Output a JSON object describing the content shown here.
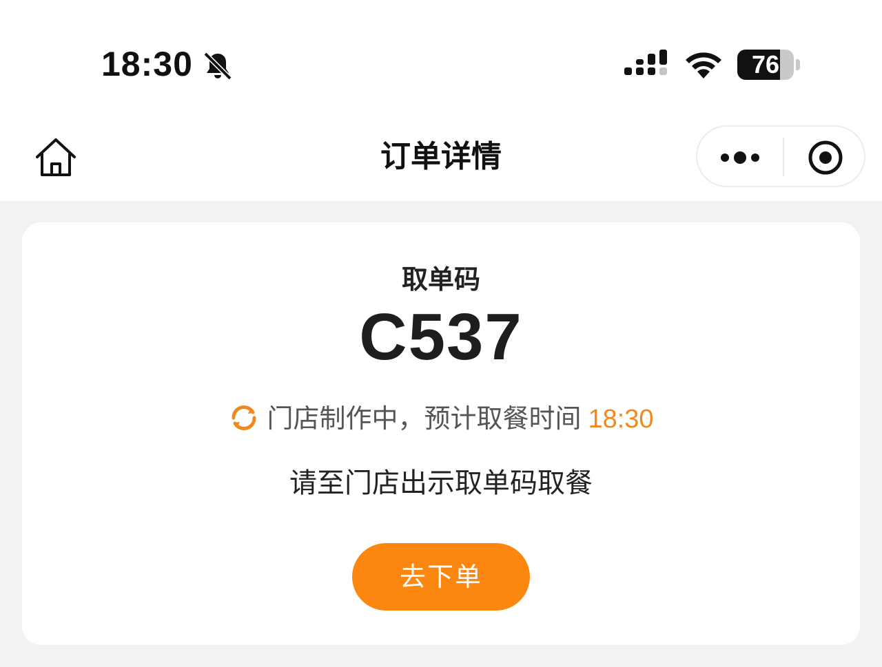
{
  "status_bar": {
    "time": "18:30",
    "battery_level": 76,
    "battery_text": "76",
    "icons": [
      "bell-slash-icon",
      "signal-icon",
      "wifi-icon",
      "battery-icon"
    ]
  },
  "nav": {
    "title": "订单详情",
    "home_icon": "home-icon",
    "more_icon": "more-dots-icon",
    "close_icon": "target-close-icon"
  },
  "card": {
    "pickup_label": "取单码",
    "pickup_code": "C537",
    "status_text": "门店制作中，预计取餐时间",
    "eta_time": "18:30",
    "instruction": "请至门店出示取单码取餐",
    "order_button_label": "去下单"
  },
  "colors": {
    "accent": "#fb8710",
    "eta": "#f08a1e",
    "page_bg": "#f2f2f2",
    "card_bg": "#ffffff"
  }
}
